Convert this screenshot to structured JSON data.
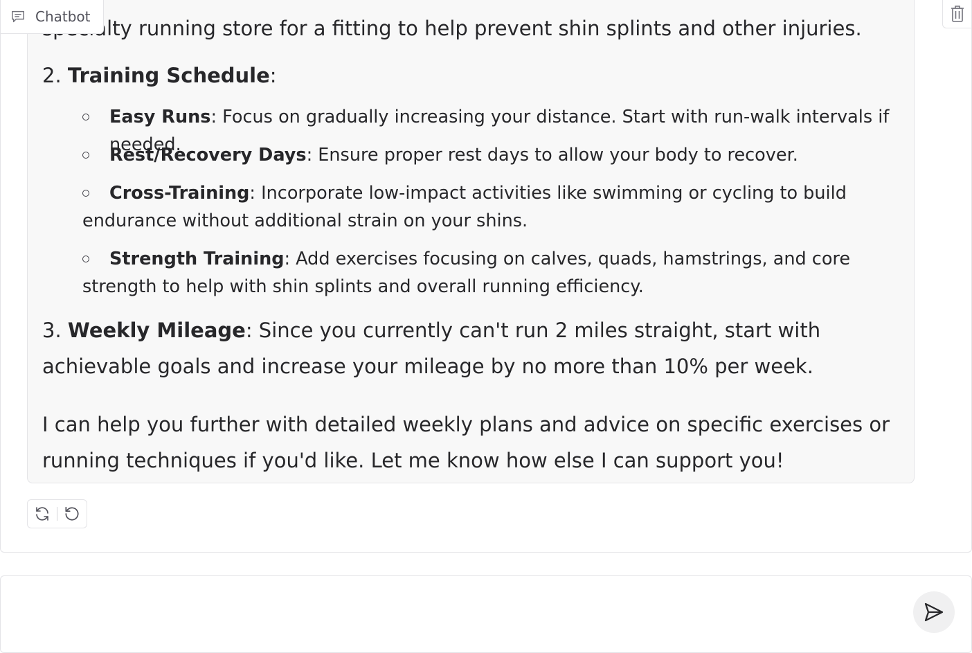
{
  "chatbot": {
    "label": "Chatbot",
    "icon": "chat-bubble-icon",
    "clear_icon": "trash-icon"
  },
  "message": {
    "cut_line": "specialty running store for a fitting to help prevent shin splints and other injuries.",
    "section2": {
      "number": "2.",
      "title": "Training Schedule",
      "suffix": ":"
    },
    "items": [
      {
        "title": "Easy Runs",
        "text": ": Focus on gradually increasing your distance. Start with run-walk intervals if needed."
      },
      {
        "title": "Rest/Recovery Days",
        "text": ": Ensure proper rest days to allow your body to recover."
      },
      {
        "title": "Cross-Training",
        "text": ": Incorporate low-impact activities like swimming or cycling to build endurance without additional strain on your shins."
      },
      {
        "title": "Strength Training",
        "text": ": Add exercises focusing on calves, quads, hamstrings, and core strength to help with shin splints and overall running efficiency."
      }
    ],
    "section3": {
      "number": "3.",
      "title": "Weekly Mileage",
      "text": ": Since you currently can't run 2 miles straight, start with achievable goals and increase your mileage by no more than 10% per week."
    },
    "closing": "I can help you further with detailed weekly plans and advice on specific exercises or running techniques if you'd like. Let me know how else I can support you!"
  },
  "actions": {
    "retry_icon": "refresh-icon",
    "undo_icon": "undo-icon"
  },
  "input": {
    "value": "",
    "send_icon": "send-icon"
  }
}
